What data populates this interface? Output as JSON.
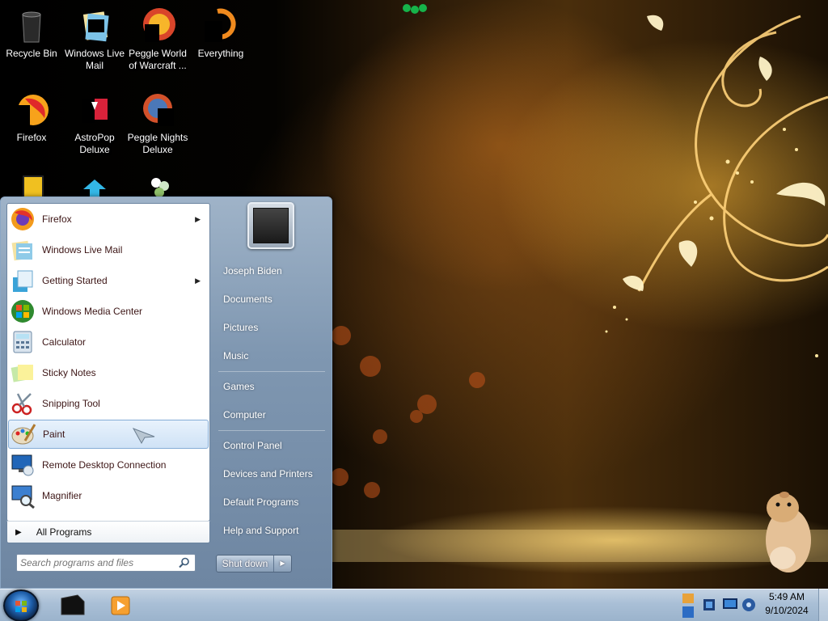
{
  "desktop": {
    "icons": [
      {
        "label": "Recycle Bin",
        "icon": "recycle-bin-icon"
      },
      {
        "label": "Windows Live Mail",
        "icon": "mail-icon"
      },
      {
        "label": "Peggle World of Warcraft ...",
        "icon": "peggle-icon"
      },
      {
        "label": "Everything",
        "icon": "search-icon"
      },
      {
        "label": "Firefox",
        "icon": "firefox-icon"
      },
      {
        "label": "AstroPop Deluxe",
        "icon": "astropop-icon"
      },
      {
        "label": "Peggle Nights Deluxe",
        "icon": "peggle-nights-icon"
      }
    ]
  },
  "start_menu": {
    "programs": [
      {
        "label": "Firefox",
        "icon": "firefox-icon",
        "has_submenu": true
      },
      {
        "label": "Windows Live Mail",
        "icon": "mail-icon",
        "has_submenu": false
      },
      {
        "label": "Getting Started",
        "icon": "getting-started-icon",
        "has_submenu": true
      },
      {
        "label": "Windows Media Center",
        "icon": "media-center-icon",
        "has_submenu": false
      },
      {
        "label": "Calculator",
        "icon": "calculator-icon",
        "has_submenu": false
      },
      {
        "label": "Sticky Notes",
        "icon": "sticky-notes-icon",
        "has_submenu": false
      },
      {
        "label": "Snipping Tool",
        "icon": "scissors-icon",
        "has_submenu": false
      },
      {
        "label": "Paint",
        "icon": "paint-palette-icon",
        "has_submenu": false,
        "highlighted": true
      },
      {
        "label": "Remote Desktop Connection",
        "icon": "remote-desktop-icon",
        "has_submenu": false
      },
      {
        "label": "Magnifier",
        "icon": "magnifier-icon",
        "has_submenu": false
      }
    ],
    "all_programs_label": "All Programs",
    "search_placeholder": "Search programs and files",
    "right_links": [
      "Joseph Biden",
      "Documents",
      "Pictures",
      "Music",
      "Games",
      "Computer",
      "Control Panel",
      "Devices and Printers",
      "Default Programs",
      "Help and Support"
    ],
    "shutdown_label": "Shut down"
  },
  "taskbar": {
    "pinned": [
      "media-device-icon",
      "media-player-icon"
    ],
    "tray_icons": [
      "flag-icon",
      "network-icon",
      "monitor-icon",
      "volume-icon"
    ],
    "clock_time": "5:49 AM",
    "clock_date": "9/10/2024"
  },
  "colors": {
    "start_menu_blue": "#7f97b1",
    "taskbar_blue": "#a9bfd6",
    "program_text": "#3d1616",
    "selection": "#cfe2f6"
  }
}
